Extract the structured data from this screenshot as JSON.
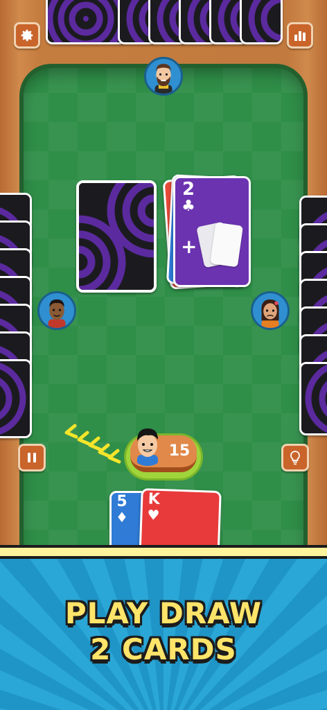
{
  "headline": {
    "line1": "PLAY DRAW",
    "line2": "2 CARDS"
  },
  "player": {
    "card_count": "15"
  },
  "discard": {
    "rank": "2",
    "suit": "♣",
    "effect_sign": "+"
  },
  "hand": [
    {
      "rank": "5",
      "suit": "♦",
      "color": "#2f7bd6"
    },
    {
      "rank": "K",
      "suit": "♥",
      "color": "#e83a3a"
    }
  ],
  "icons": {
    "settings": "gear-icon",
    "stats": "bar-chart-icon",
    "pause": "pause-icon",
    "hint": "lightbulb-icon"
  },
  "colors": {
    "card_back": "#5b2a9e",
    "discard": "#6b33b0",
    "table": "#2f8e48",
    "wood": "#c27a3e",
    "headline": "#ffe46a"
  }
}
